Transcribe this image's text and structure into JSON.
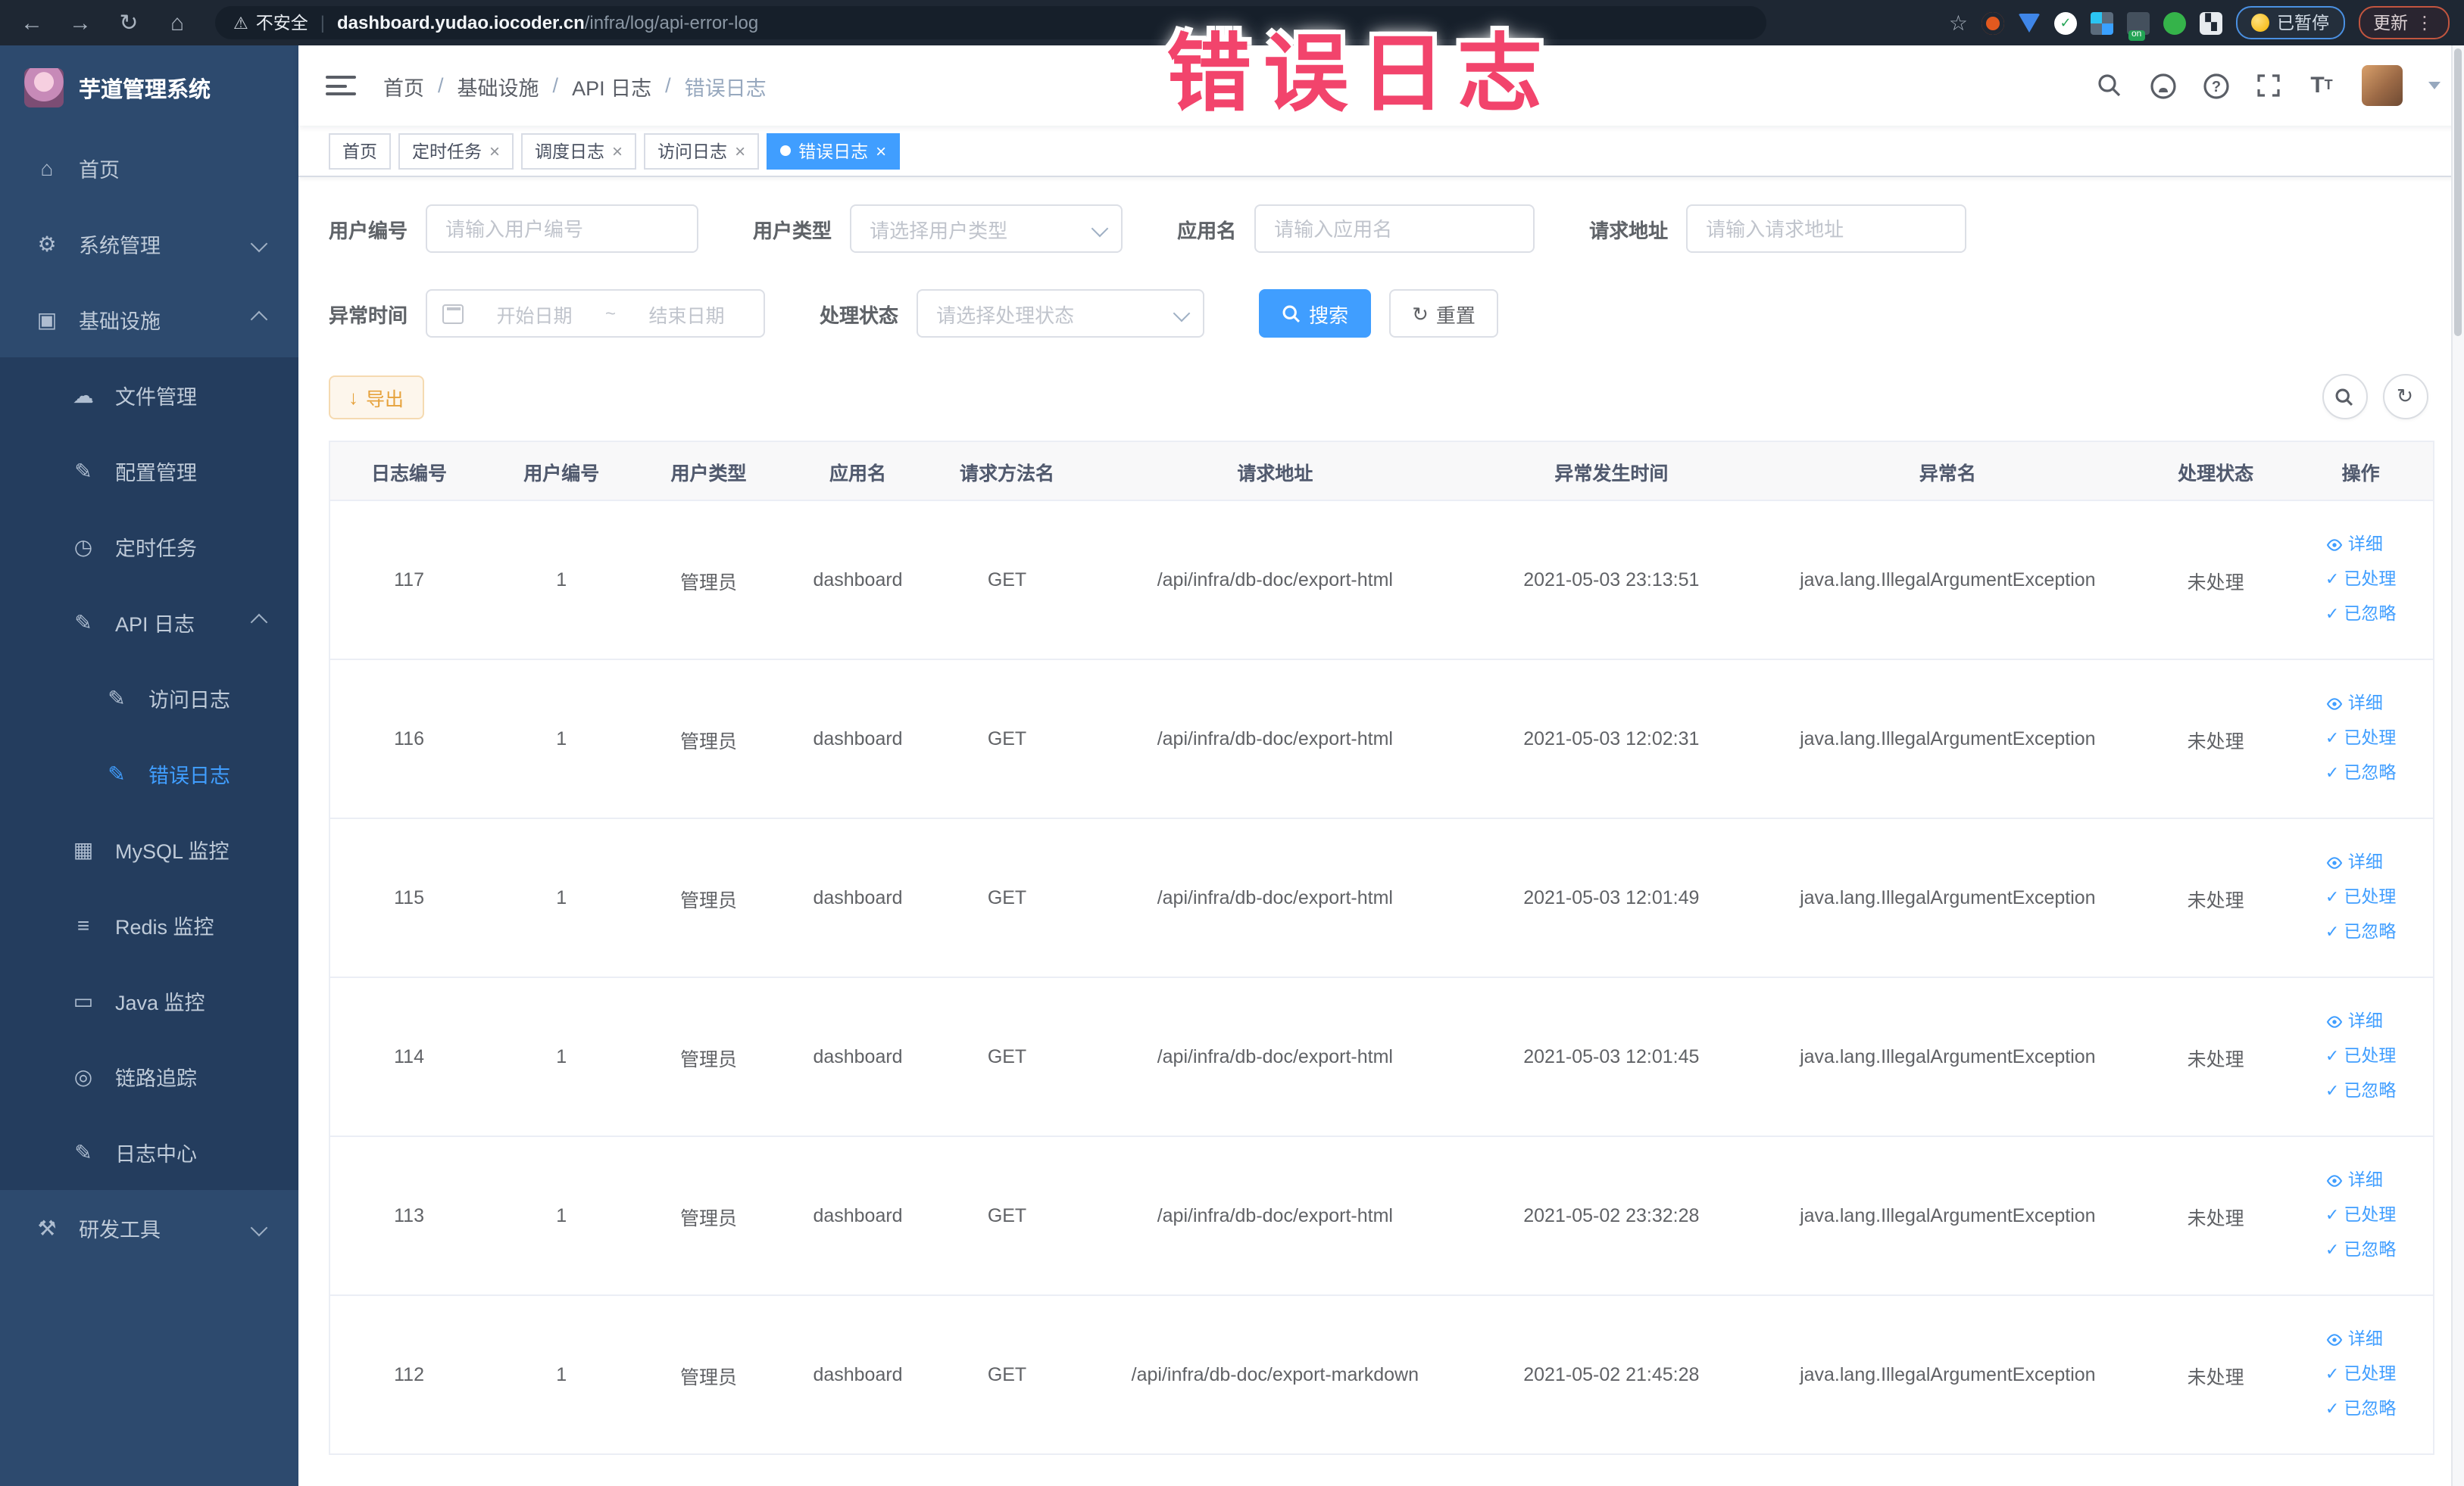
{
  "browser": {
    "security_label": "不安全",
    "url_separator": "|",
    "url_host": "dashboard.yudao.iocoder.cn",
    "url_path": "/infra/log/api-error-log",
    "paused_badge": "已暂停",
    "update_badge": "更新",
    "menu_dots": "⋮"
  },
  "annotation": {
    "text": "错误日志"
  },
  "ui": {
    "close_symbol": "×",
    "back": "←",
    "forward": "→",
    "reload": "↻",
    "home": "⌂",
    "star": "☆",
    "warning_triangle": "⚠",
    "check": "✓",
    "download": "↓",
    "refresh": "↻"
  },
  "icons": {
    "home-icon": "⌂",
    "gear-icon": "⚙",
    "infra-icon": "▣",
    "upload-icon": "☁",
    "config-icon": "✎",
    "timer-icon": "◷",
    "apilog-icon": "✎",
    "accesslog-icon": "✎",
    "errorlog-icon": "✎",
    "mysql-icon": "▦",
    "redis-icon": "≡",
    "java-icon": "▭",
    "trace-icon": "◎",
    "logcenter-icon": "✎",
    "tools-icon": "⚒"
  },
  "sidebar": {
    "title": "芋道管理系统",
    "items": [
      {
        "name": "home",
        "label": "首页",
        "icon": "home-icon",
        "level": 1
      },
      {
        "name": "system",
        "label": "系统管理",
        "icon": "gear-icon",
        "level": 1,
        "arrow": "down"
      },
      {
        "name": "infra",
        "label": "基础设施",
        "icon": "infra-icon",
        "level": 1,
        "arrow": "up"
      },
      {
        "name": "file",
        "label": "文件管理",
        "icon": "upload-icon",
        "level": 2
      },
      {
        "name": "config",
        "label": "配置管理",
        "icon": "config-icon",
        "level": 2
      },
      {
        "name": "job",
        "label": "定时任务",
        "icon": "timer-icon",
        "level": 2
      },
      {
        "name": "api-log",
        "label": "API 日志",
        "icon": "apilog-icon",
        "level": 2,
        "arrow": "up"
      },
      {
        "name": "access-log",
        "label": "访问日志",
        "icon": "accesslog-icon",
        "level": 3
      },
      {
        "name": "error-log",
        "label": "错误日志",
        "icon": "errorlog-icon",
        "level": 3,
        "active": true
      },
      {
        "name": "mysql",
        "label": "MySQL 监控",
        "icon": "mysql-icon",
        "level": 2
      },
      {
        "name": "redis",
        "label": "Redis 监控",
        "icon": "redis-icon",
        "level": 2
      },
      {
        "name": "java",
        "label": "Java 监控",
        "icon": "java-icon",
        "level": 2
      },
      {
        "name": "trace",
        "label": "链路追踪",
        "icon": "trace-icon",
        "level": 2
      },
      {
        "name": "log-center",
        "label": "日志中心",
        "icon": "logcenter-icon",
        "level": 2
      },
      {
        "name": "dev-tools",
        "label": "研发工具",
        "icon": "tools-icon",
        "level": 1,
        "arrow": "down"
      }
    ]
  },
  "breadcrumb": {
    "separator": "/",
    "items": [
      {
        "name": "home",
        "label": "首页"
      },
      {
        "name": "infra",
        "label": "基础设施"
      },
      {
        "name": "api-log",
        "label": "API 日志"
      },
      {
        "name": "error-log",
        "label": "错误日志"
      }
    ]
  },
  "tags": [
    {
      "name": "home",
      "label": "首页",
      "closable": false,
      "active": false
    },
    {
      "name": "job",
      "label": "定时任务",
      "closable": true,
      "active": false
    },
    {
      "name": "job-log",
      "label": "调度日志",
      "closable": true,
      "active": false
    },
    {
      "name": "access-log",
      "label": "访问日志",
      "closable": true,
      "active": false
    },
    {
      "name": "error-log",
      "label": "错误日志",
      "closable": true,
      "active": true
    }
  ],
  "filters": {
    "user_id": {
      "label": "用户编号",
      "placeholder": "请输入用户编号"
    },
    "user_type": {
      "label": "用户类型",
      "placeholder": "请选择用户类型"
    },
    "app_name": {
      "label": "应用名",
      "placeholder": "请输入应用名"
    },
    "request_url": {
      "label": "请求地址",
      "placeholder": "请输入请求地址"
    },
    "exception_time": {
      "label": "异常时间",
      "start_placeholder": "开始日期",
      "separator": "~",
      "end_placeholder": "结束日期"
    },
    "process_status": {
      "label": "处理状态",
      "placeholder": "请选择处理状态"
    },
    "search_label": "搜索",
    "reset_label": "重置"
  },
  "toolbar": {
    "export_label": "导出"
  },
  "table": {
    "columns": [
      "日志编号",
      "用户编号",
      "用户类型",
      "应用名",
      "请求方法名",
      "请求地址",
      "异常发生时间",
      "异常名",
      "处理状态",
      "操作"
    ],
    "actions": [
      {
        "name": "detail",
        "label": "详细"
      },
      {
        "name": "processed",
        "label": "已处理"
      },
      {
        "name": "ignored",
        "label": "已忽略"
      }
    ],
    "rows": [
      {
        "id": "117",
        "user_id": "1",
        "user_type": "管理员",
        "app": "dashboard",
        "method": "GET",
        "url": "/api/infra/db-doc/export-html",
        "time": "2021-05-03 23:13:51",
        "exception": "java.lang.IllegalArgumentException",
        "status": "未处理"
      },
      {
        "id": "116",
        "user_id": "1",
        "user_type": "管理员",
        "app": "dashboard",
        "method": "GET",
        "url": "/api/infra/db-doc/export-html",
        "time": "2021-05-03 12:02:31",
        "exception": "java.lang.IllegalArgumentException",
        "status": "未处理"
      },
      {
        "id": "115",
        "user_id": "1",
        "user_type": "管理员",
        "app": "dashboard",
        "method": "GET",
        "url": "/api/infra/db-doc/export-html",
        "time": "2021-05-03 12:01:49",
        "exception": "java.lang.IllegalArgumentException",
        "status": "未处理"
      },
      {
        "id": "114",
        "user_id": "1",
        "user_type": "管理员",
        "app": "dashboard",
        "method": "GET",
        "url": "/api/infra/db-doc/export-html",
        "time": "2021-05-03 12:01:45",
        "exception": "java.lang.IllegalArgumentException",
        "status": "未处理"
      },
      {
        "id": "113",
        "user_id": "1",
        "user_type": "管理员",
        "app": "dashboard",
        "method": "GET",
        "url": "/api/infra/db-doc/export-html",
        "time": "2021-05-02 23:32:28",
        "exception": "java.lang.IllegalArgumentException",
        "status": "未处理"
      },
      {
        "id": "112",
        "user_id": "1",
        "user_type": "管理员",
        "app": "dashboard",
        "method": "GET",
        "url": "/api/infra/db-doc/export-markdown",
        "time": "2021-05-02 21:45:28",
        "exception": "java.lang.IllegalArgumentException",
        "status": "未处理"
      }
    ]
  },
  "colors": {
    "accent": "#409eff",
    "warning": "#e6a23c",
    "annotation": "#f2446c",
    "chrome_bg": "#1e2733",
    "sidebar_bg": "#2d4a6e",
    "sidebar_sub_bg": "#243d5e"
  }
}
